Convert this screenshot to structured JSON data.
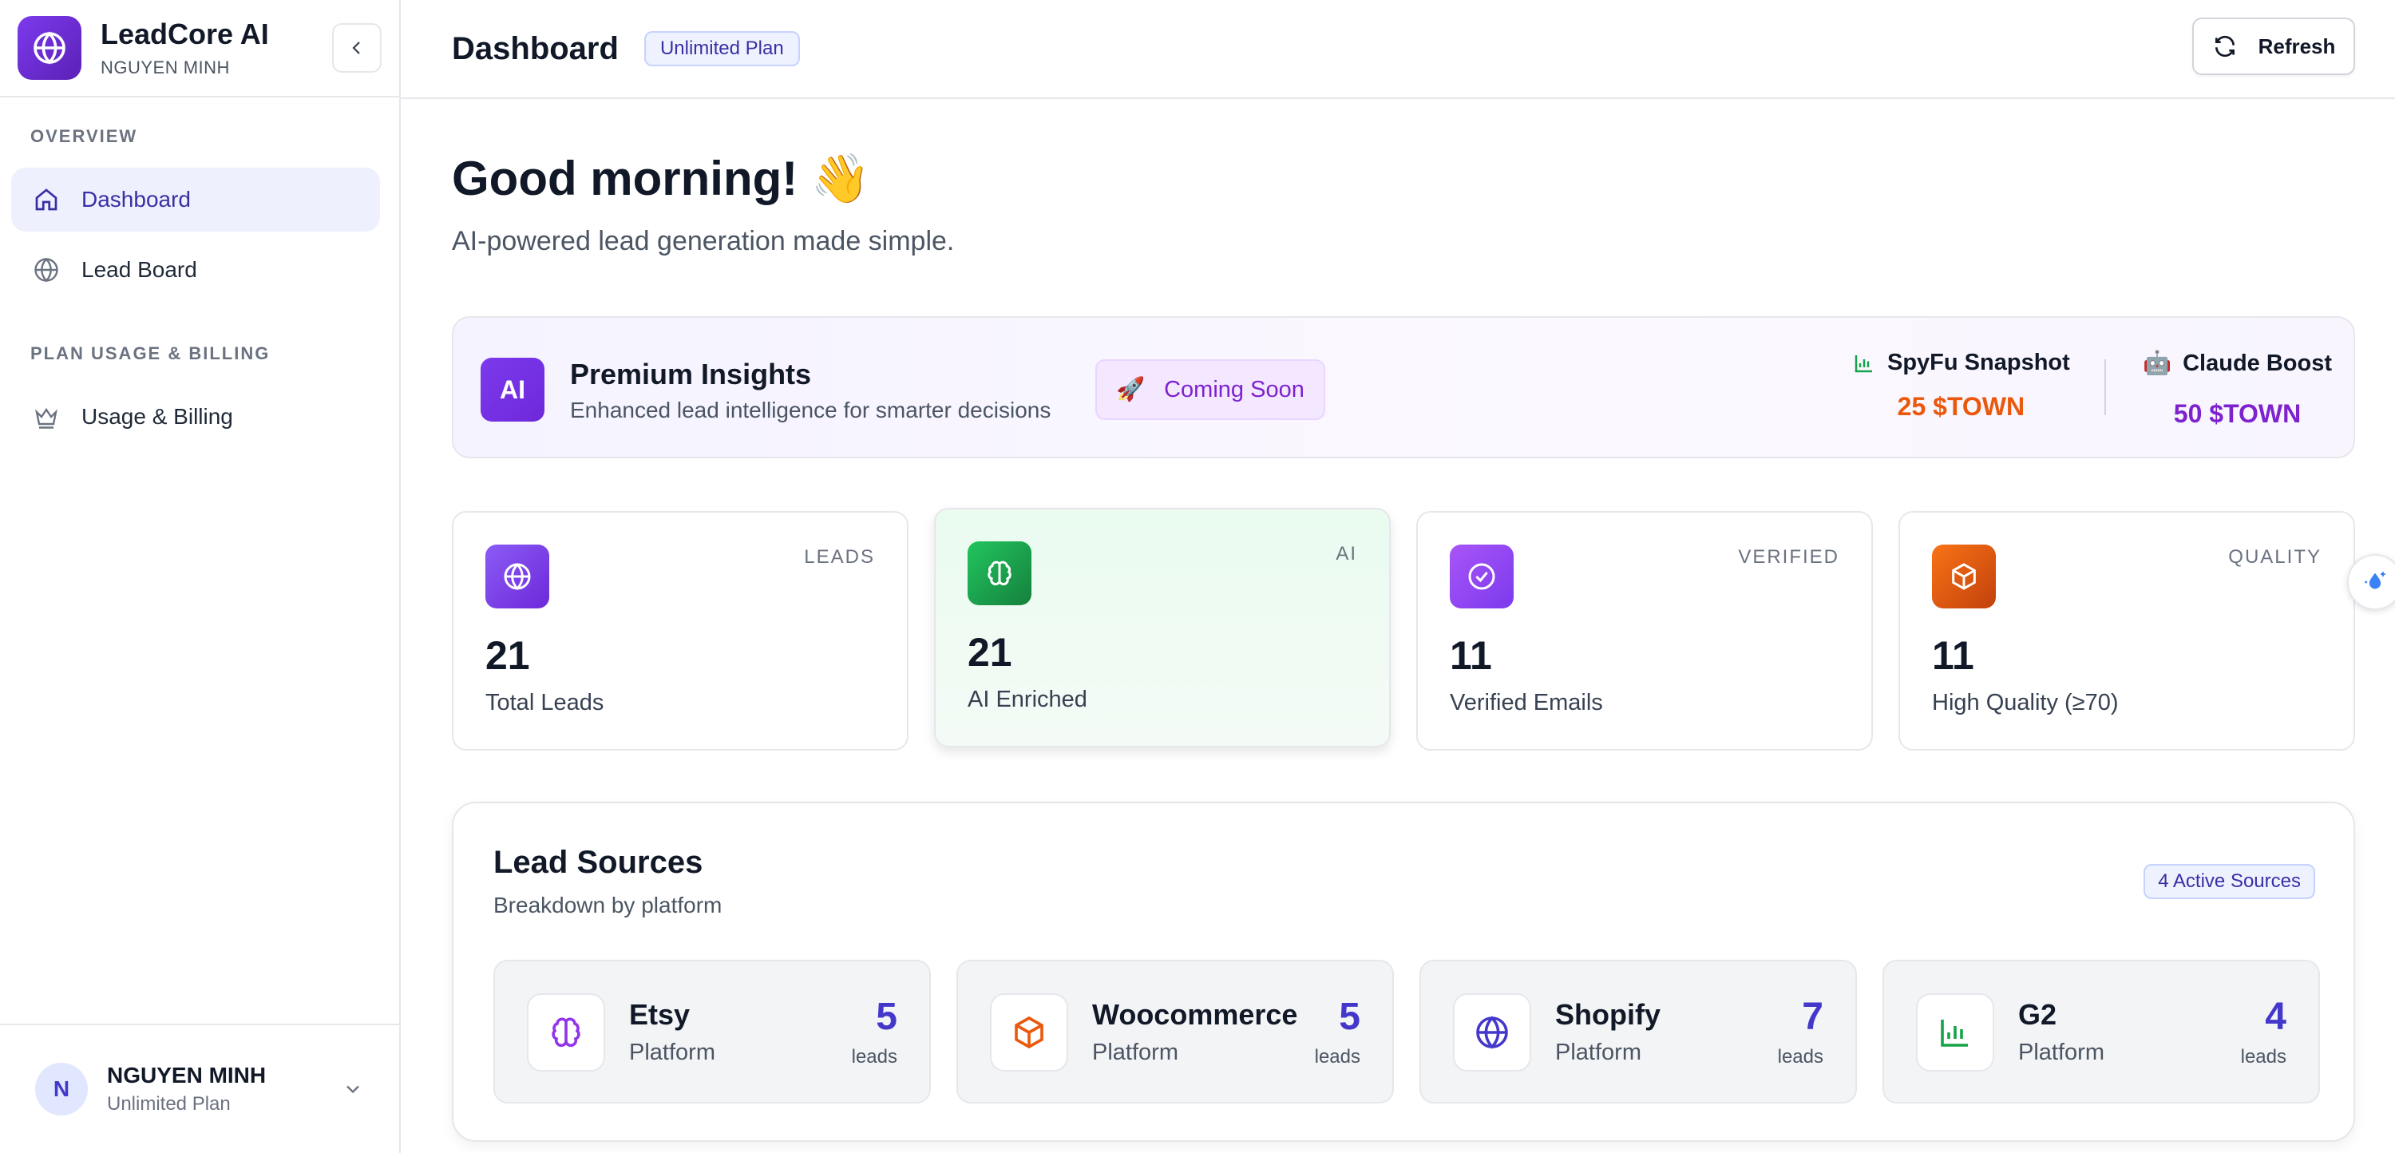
{
  "app": {
    "name": "LeadCore AI",
    "user": "NGUYEN MINH"
  },
  "sidebar": {
    "sections": [
      {
        "title": "OVERVIEW"
      },
      {
        "title": "PLAN USAGE & BILLING"
      }
    ],
    "items": [
      {
        "label": "Dashboard",
        "icon": "home-icon",
        "active": true
      },
      {
        "label": "Lead Board",
        "icon": "globe-icon"
      },
      {
        "label": "Usage & Billing",
        "icon": "crown-icon"
      }
    ],
    "footer": {
      "avatar_initial": "N",
      "name": "NGUYEN MINH",
      "plan": "Unlimited Plan"
    }
  },
  "header": {
    "title": "Dashboard",
    "plan_badge": "Unlimited Plan",
    "refresh_label": "Refresh"
  },
  "greeting": {
    "title": "Good morning! 👋",
    "subtitle": "AI-powered lead generation made simple."
  },
  "insights": {
    "badge": "AI",
    "title": "Premium Insights",
    "subtitle": "Enhanced lead intelligence for smarter decisions",
    "coming_soon": "Coming Soon",
    "offers": [
      {
        "name": "SpyFu Snapshot",
        "price": "25 $TOWN",
        "color": "#ea580c"
      },
      {
        "name": "Claude Boost",
        "price": "50 $TOWN",
        "color": "#7e22ce"
      }
    ]
  },
  "stats": [
    {
      "tag": "LEADS",
      "value": "21",
      "label": "Total Leads",
      "icon": "globe-icon",
      "color": "#7c3aed"
    },
    {
      "tag": "AI",
      "value": "21",
      "label": "AI Enriched",
      "icon": "brain-icon",
      "color": "#16a34a"
    },
    {
      "tag": "VERIFIED",
      "value": "11",
      "label": "Verified Emails",
      "icon": "check-circle-icon",
      "color": "#7c3aed"
    },
    {
      "tag": "QUALITY",
      "value": "11",
      "label": "High Quality (≥70)",
      "icon": "box-icon",
      "color": "#ea580c"
    }
  ],
  "sources": {
    "title": "Lead Sources",
    "subtitle": "Breakdown by platform",
    "active_badge": "4 Active Sources",
    "items": [
      {
        "name": "Etsy",
        "type": "Platform",
        "count": "5",
        "unit": "leads",
        "icon": "brain-icon",
        "color": "#9333ea"
      },
      {
        "name": "Woocommerce",
        "type": "Platform",
        "count": "5",
        "unit": "leads",
        "icon": "box-icon",
        "color": "#ea580c"
      },
      {
        "name": "Shopify",
        "type": "Platform",
        "count": "7",
        "unit": "leads",
        "icon": "globe-icon",
        "color": "#4338ca"
      },
      {
        "name": "G2",
        "type": "Platform",
        "count": "4",
        "unit": "leads",
        "icon": "bar-chart-icon",
        "color": "#16a34a"
      }
    ]
  }
}
